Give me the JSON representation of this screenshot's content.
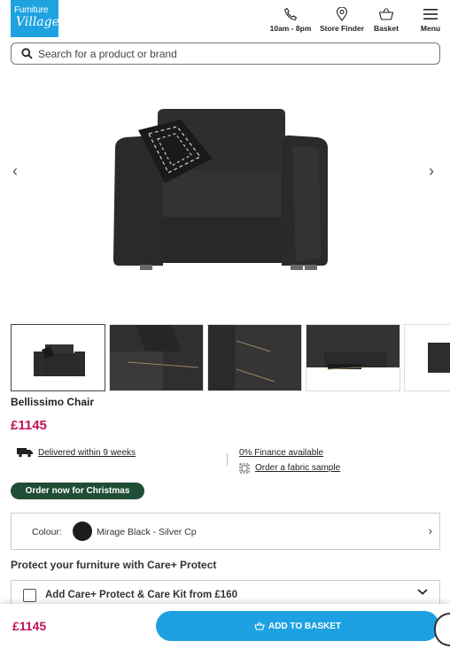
{
  "header": {
    "logo_line1": "Furniture",
    "logo_line2": "Village",
    "hours_label": "10am - 8pm",
    "store_finder_label": "Store Finder",
    "basket_label": "Basket",
    "menu_label": "Menu"
  },
  "search": {
    "placeholder": "Search for a product or brand"
  },
  "gallery": {
    "prev_arrow": "‹",
    "next_arrow": "›",
    "thumbnail_count": 5,
    "active_thumbnail": 1
  },
  "product": {
    "title": "Bellissimo Chair",
    "price": "£1145"
  },
  "info": {
    "delivery_link": "Delivered within 9 weeks",
    "finance_link": "0% Finance available",
    "sample_link": "Order a fabric sample"
  },
  "badge": {
    "label": "Order now for Christmas"
  },
  "colour": {
    "label": "Colour:",
    "value": "Mirage Black - Silver Cp",
    "swatch_color": "#1c1c1c"
  },
  "care": {
    "heading": "Protect your furniture with Care+ Protect",
    "option_label": "Add Care+ Protect & Care Kit from £160"
  },
  "bottom_bar": {
    "price": "£1145",
    "add_to_basket_label": "ADD TO BASKET"
  },
  "colors": {
    "brand_blue": "#1ea1e2",
    "price_pink": "#c0135a",
    "badge_green": "#1f4d36"
  }
}
